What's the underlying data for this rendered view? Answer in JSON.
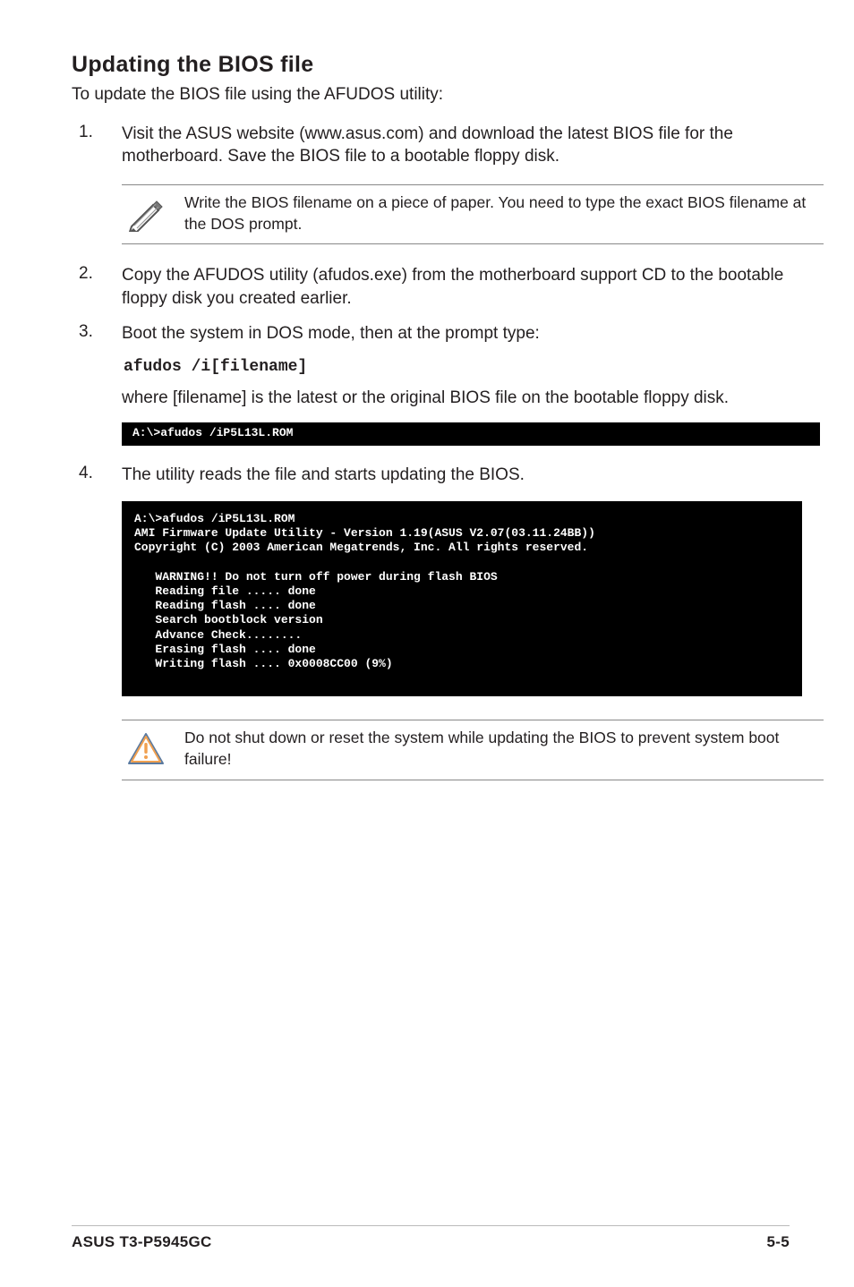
{
  "heading": "Updating the BIOS file",
  "intro": "To update the BIOS file using the AFUDOS utility:",
  "step1_num": "1.",
  "step1_text": "Visit the ASUS website (www.asus.com) and download the latest BIOS file for the motherboard. Save the BIOS file to a bootable floppy disk.",
  "note_text": "Write the BIOS filename on a piece of paper. You need to type the exact BIOS filename at the DOS prompt.",
  "step2_num": "2.",
  "step2_text": "Copy the AFUDOS utility (afudos.exe) from the motherboard support CD to the bootable floppy disk you created earlier.",
  "step3_num": "3.",
  "step3_text": "Boot the system in DOS mode, then at the prompt type:",
  "cmd_inline": "afudos /i[filename]",
  "step3_cont": "where [filename] is the latest or the original BIOS file on the bootable floppy disk.",
  "code_narrow": "A:\\>afudos /iP5L13L.ROM",
  "step4_num": "4.",
  "step4_text": "The utility reads the file and starts updating the BIOS.",
  "code_wide": "A:\\>afudos /iP5L13L.ROM\nAMI Firmware Update Utility - Version 1.19(ASUS V2.07(03.11.24BB))\nCopyright (C) 2003 American Megatrends, Inc. All rights reserved.\n\n   WARNING!! Do not turn off power during flash BIOS\n   Reading file ..... done\n   Reading flash .... done\n   Search bootblock version\n   Advance Check........\n   Erasing flash .... done\n   Writing flash .... 0x0008CC00 (9%)",
  "warn_text": "Do not shut down or reset the system while updating the BIOS to prevent system boot failure!",
  "footer_left": "ASUS T3-P5945GC",
  "footer_right": "5-5"
}
